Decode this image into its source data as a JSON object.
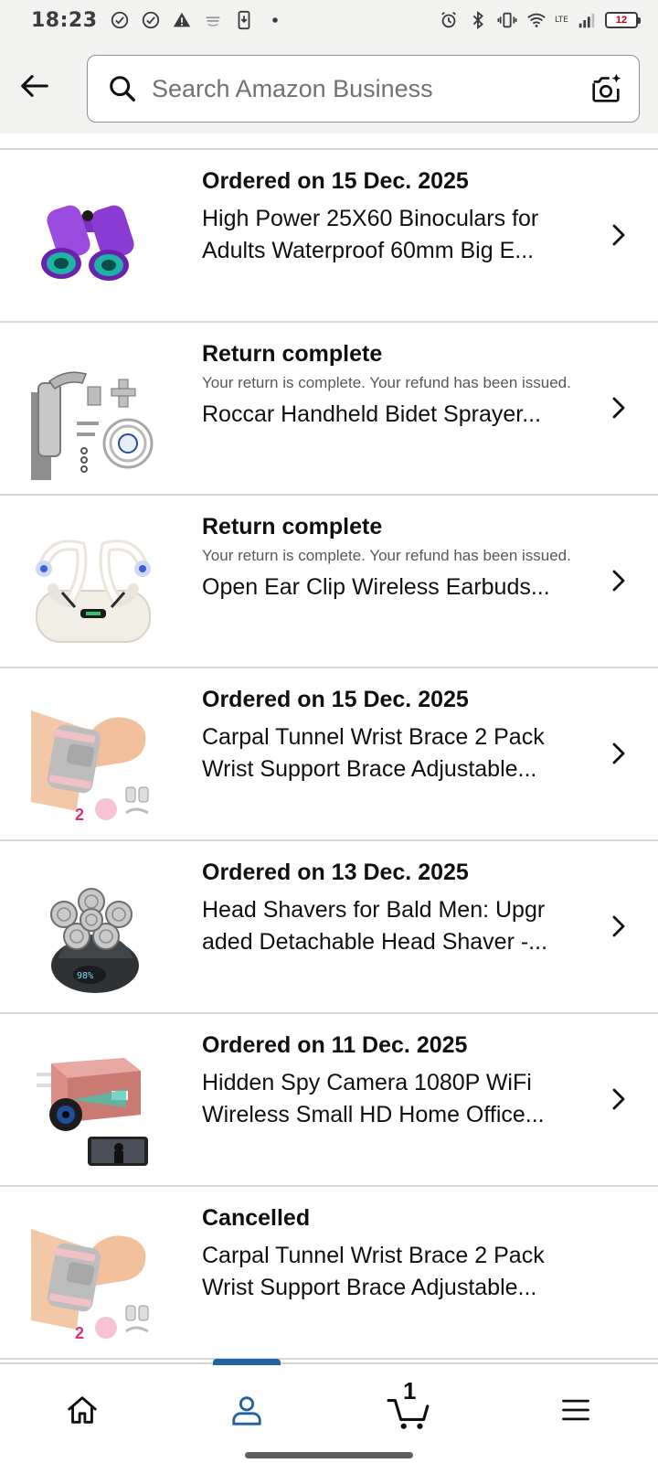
{
  "status_bar": {
    "time": "18:23",
    "battery_level": "12",
    "network_label": "LTE"
  },
  "header": {
    "search_placeholder": "Search Amazon Business"
  },
  "orders": [
    {
      "status": "Ordered on 15 Dec. 2025",
      "subtitle": "",
      "title": "High Power 25X60 Binoculars for Adults Waterproof 60mm Big E...",
      "image": "binoculars-image"
    },
    {
      "status": "Return complete",
      "subtitle": "Your return is complete. Your refund has been issued.",
      "title": "Roccar Handheld Bidet Sprayer...",
      "image": "bidet-sprayer-image"
    },
    {
      "status": "Return complete",
      "subtitle": "Your return is complete. Your refund has been issued.",
      "title": "Open Ear Clip Wireless Earbuds...",
      "image": "earbuds-image"
    },
    {
      "status": "Ordered on 15 Dec. 2025",
      "subtitle": "",
      "title": "Carpal Tunnel Wrist Brace 2 Pack Wrist Support Brace Adjustable...",
      "image": "wrist-brace-image"
    },
    {
      "status": "Ordered on 13 Dec. 2025",
      "subtitle": "",
      "title": "Head Shavers for Bald Men: Upgr aded Detachable Head Shaver -...",
      "image": "head-shaver-image"
    },
    {
      "status": "Ordered on 11 Dec. 2025",
      "subtitle": "",
      "title": "Hidden Spy Camera 1080P WiFi Wireless Small HD Home Office...",
      "image": "spy-camera-image"
    },
    {
      "status": "Cancelled",
      "subtitle": "",
      "title": "Carpal Tunnel Wrist Brace 2 Pack Wrist Support Brace Adjustable...",
      "image": "wrist-brace-image"
    }
  ],
  "bottom_nav": {
    "items": [
      "home-icon",
      "account-icon",
      "cart-icon",
      "menu-icon"
    ],
    "active": "account-icon",
    "cart_count": "1"
  },
  "colors": {
    "accent": "#2162a1",
    "header_bg": "#f2f2f0",
    "divider": "#d5d9d9",
    "battery_low": "#c40000"
  }
}
